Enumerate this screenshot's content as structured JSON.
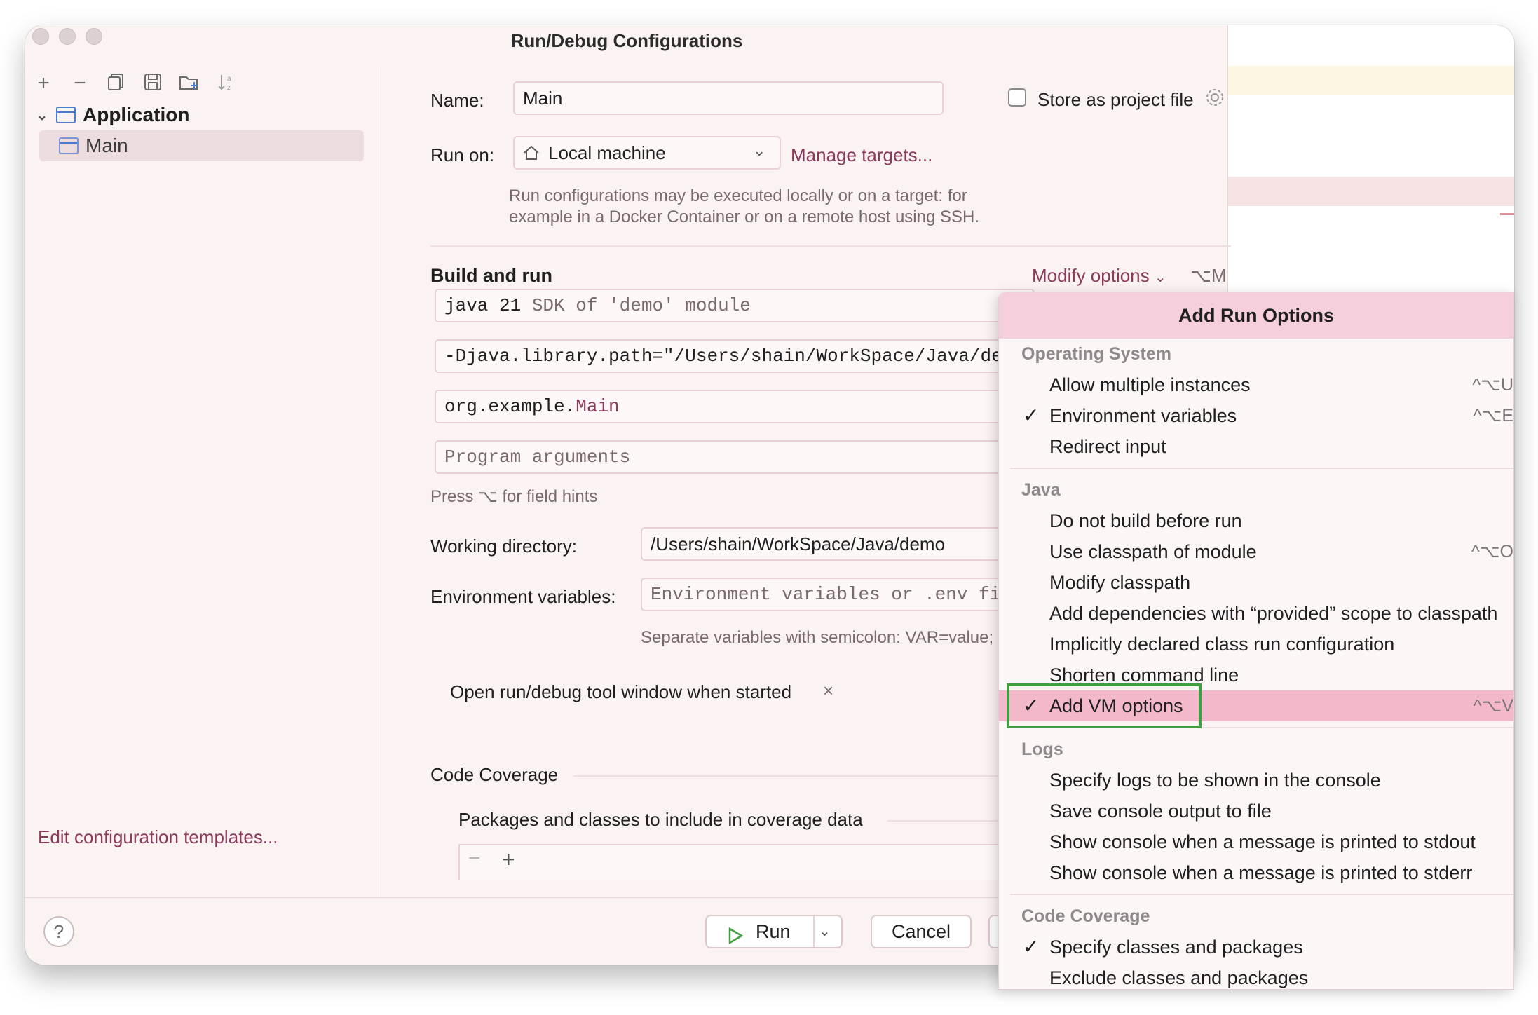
{
  "window": {
    "title": "Run/Debug Configurations"
  },
  "left": {
    "tree": {
      "parent": "Application",
      "child": "Main"
    },
    "edit_templates": "Edit configuration templates..."
  },
  "form": {
    "name_label": "Name:",
    "name_value": "Main",
    "store_label": "Store as project file",
    "run_on_label": "Run on:",
    "run_on_value": "Local machine",
    "manage_targets": "Manage targets...",
    "run_on_hint_1": "Run configurations may be executed locally or on a target: for",
    "run_on_hint_2": "example in a Docker Container or on a remote host using SSH.",
    "build_and_run": "Build and run",
    "modify_options": "Modify options",
    "modify_shortcut": "⌥M",
    "sdk_strong": "java 21",
    "sdk_rest": " SDK of 'demo' module",
    "vm_options": "-Djava.library.path=\"/Users/shain/WorkSpace/Java/demo,",
    "main_class_pkg": "org.example.",
    "main_class_name": "Main",
    "program_args_placeholder": "Program arguments",
    "field_hints": "Press ⌥ for field hints",
    "working_dir_label": "Working directory:",
    "working_dir_value": "/Users/shain/WorkSpace/Java/demo",
    "env_label": "Environment variables:",
    "env_placeholder": "Environment variables or .env file",
    "env_hint": "Separate variables with semicolon: VAR=value; V",
    "open_tool_window": "Open run/debug tool window when started",
    "code_coverage": "Code Coverage",
    "coverage_packages": "Packages and classes to include in coverage data"
  },
  "buttons": {
    "help": "?",
    "run": "Run",
    "cancel": "Cancel"
  },
  "popup": {
    "title": "Add Run Options",
    "groups": [
      {
        "name": "Operating System",
        "items": [
          {
            "label": "Allow multiple instances",
            "checked": false,
            "shortcut": "^⌥U"
          },
          {
            "label": "Environment variables",
            "checked": true,
            "shortcut": "^⌥E"
          },
          {
            "label": "Redirect input",
            "checked": false,
            "shortcut": ""
          }
        ]
      },
      {
        "name": "Java",
        "items": [
          {
            "label": "Do not build before run",
            "checked": false,
            "shortcut": ""
          },
          {
            "label": "Use classpath of module",
            "checked": false,
            "shortcut": "^⌥O"
          },
          {
            "label": "Modify classpath",
            "checked": false,
            "shortcut": ""
          },
          {
            "label": "Add dependencies with “provided” scope to classpath",
            "checked": false,
            "shortcut": ""
          },
          {
            "label": "Implicitly declared class run configuration",
            "checked": false,
            "shortcut": ""
          },
          {
            "label": "Shorten command line",
            "checked": false,
            "shortcut": ""
          },
          {
            "label": "Add VM options",
            "checked": true,
            "shortcut": "^⌥V",
            "selected": true
          }
        ]
      },
      {
        "name": "Logs",
        "items": [
          {
            "label": "Specify logs to be shown in the console",
            "checked": false,
            "shortcut": ""
          },
          {
            "label": "Save console output to file",
            "checked": false,
            "shortcut": ""
          },
          {
            "label": "Show console when a message is printed to stdout",
            "checked": false,
            "shortcut": ""
          },
          {
            "label": "Show console when a message is printed to stderr",
            "checked": false,
            "shortcut": ""
          }
        ]
      },
      {
        "name": "Code Coverage",
        "items": [
          {
            "label": "Specify classes and packages",
            "checked": true,
            "shortcut": ""
          },
          {
            "label": "Exclude classes and packages",
            "checked": false,
            "shortcut": ""
          }
        ]
      }
    ]
  },
  "colors": {
    "accent": "#8a3a5a",
    "selection": "#f3b9cb",
    "highlight_box": "#3f9e3f"
  }
}
